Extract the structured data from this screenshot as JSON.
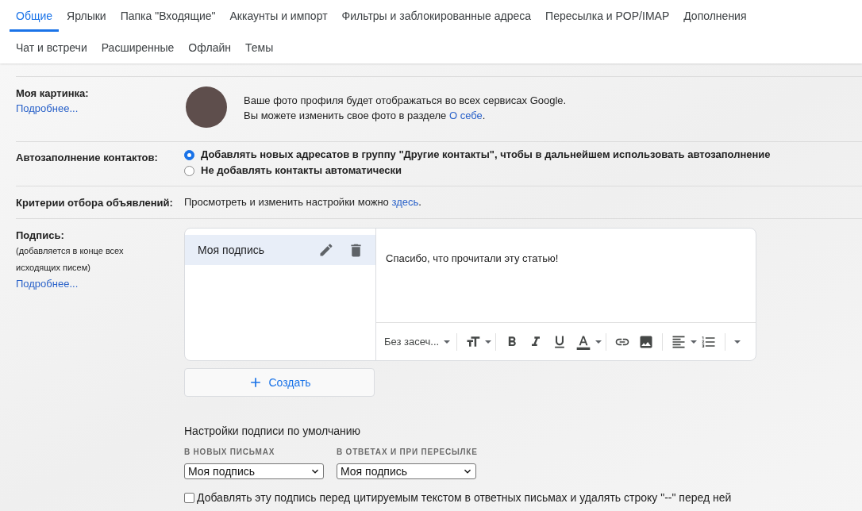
{
  "tabs": [
    {
      "label": "Общие",
      "selected": true
    },
    {
      "label": "Ярлыки",
      "selected": false
    },
    {
      "label": "Папка \"Входящие\"",
      "selected": false
    },
    {
      "label": "Аккаунты и импорт",
      "selected": false
    },
    {
      "label": "Фильтры и заблокированные адреса",
      "selected": false
    },
    {
      "label": "Пересылка и POP/IMAP",
      "selected": false
    },
    {
      "label": "Дополнения",
      "selected": false
    },
    {
      "label": "Чат и встречи",
      "selected": false
    },
    {
      "label": "Расширенные",
      "selected": false
    },
    {
      "label": "Офлайн",
      "selected": false
    },
    {
      "label": "Темы",
      "selected": false
    }
  ],
  "picture": {
    "label": "Моя картинка:",
    "link": "Подробнее...",
    "line_1": "Ваше фото профиля будет отображаться во всех сервисах Google.",
    "line_2": "Вы можете изменить свое фото в разделе",
    "line_2_link": "О себе",
    "line_2_end": "."
  },
  "autocomplete": {
    "label": "Автозаполнение контактов:",
    "options": [
      {
        "label": "Добавлять новых адресатов в группу \"Другие контакты\", чтобы в дальнейшем использовать автозаполнение",
        "selected": true
      },
      {
        "label": "Не добавлять контакты автоматически",
        "selected": false
      }
    ]
  },
  "ads": {
    "label": "Критерии отбора объявлений:",
    "text": "Просмотреть и изменить настройки можно",
    "link": "здесь",
    "end": "."
  },
  "signature": {
    "label": "Подпись:",
    "note": "(добавляется в конце всех исходящих писем)",
    "link": "Подробнее...",
    "items": [
      {
        "name": "Моя подпись",
        "selected": true
      }
    ],
    "editor_text": "Спасибо, что прочитали эту статью!",
    "font": "Без засеч...",
    "create_button": "Создать"
  },
  "signature_defaults": {
    "title": "Настройки подписи по умолчанию",
    "selects": [
      {
        "label": "В НОВЫХ ПИСЬМАХ",
        "value": "Моя подпись"
      },
      {
        "label": "В ОТВЕТАХ И ПРИ ПЕРЕСЫЛКЕ",
        "value": "Моя подпись"
      }
    ],
    "before_quote": {
      "label": "Добавлять эту подпись перед цитируемым текстом в ответных письмах и удалять строку \"--\" перед ней",
      "checked": false
    }
  }
}
